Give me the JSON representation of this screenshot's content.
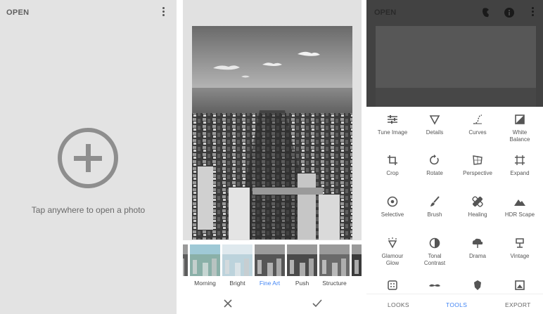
{
  "panel1": {
    "open_label": "OPEN",
    "menu_icon": "more-vert-icon",
    "open_icon": "add-circle-icon",
    "hint": "Tap anywhere to open a photo"
  },
  "panel2": {
    "looks": [
      {
        "label": "ow"
      },
      {
        "label": "Morning"
      },
      {
        "label": "Bright"
      },
      {
        "label": "Fine Art",
        "selected": true
      },
      {
        "label": "Push"
      },
      {
        "label": "Structure"
      },
      {
        "label": "Si"
      }
    ],
    "cancel_icon": "close-icon",
    "apply_icon": "check-icon",
    "accent": "#4285f4"
  },
  "panel3": {
    "open_label": "OPEN",
    "top_icons": [
      "style-icon",
      "info-icon",
      "more-vert-icon"
    ],
    "tools": [
      {
        "label": "Tune Image",
        "icon": "tune-icon"
      },
      {
        "label": "Details",
        "icon": "details-icon"
      },
      {
        "label": "Curves",
        "icon": "curves-icon"
      },
      {
        "label": "White Balance",
        "icon": "white-balance-icon"
      },
      {
        "label": "Crop",
        "icon": "crop-icon"
      },
      {
        "label": "Rotate",
        "icon": "rotate-icon"
      },
      {
        "label": "Perspective",
        "icon": "perspective-icon"
      },
      {
        "label": "Expand",
        "icon": "expand-icon"
      },
      {
        "label": "Selective",
        "icon": "selective-icon"
      },
      {
        "label": "Brush",
        "icon": "brush-icon"
      },
      {
        "label": "Healing",
        "icon": "healing-icon"
      },
      {
        "label": "HDR Scape",
        "icon": "hdr-scape-icon"
      },
      {
        "label": "Glamour Glow",
        "icon": "glamour-glow-icon"
      },
      {
        "label": "Tonal Contrast",
        "icon": "tonal-contrast-icon"
      },
      {
        "label": "Drama",
        "icon": "drama-icon"
      },
      {
        "label": "Vintage",
        "icon": "vintage-icon"
      },
      {
        "label": "",
        "icon": "grainy-film-icon"
      },
      {
        "label": "",
        "icon": "mustache-icon"
      },
      {
        "label": "",
        "icon": "grunge-icon"
      },
      {
        "label": "",
        "icon": "frames-icon"
      }
    ],
    "tabs": [
      {
        "label": "LOOKS",
        "active": false
      },
      {
        "label": "TOOLS",
        "active": true
      },
      {
        "label": "EXPORT",
        "active": false
      }
    ]
  }
}
